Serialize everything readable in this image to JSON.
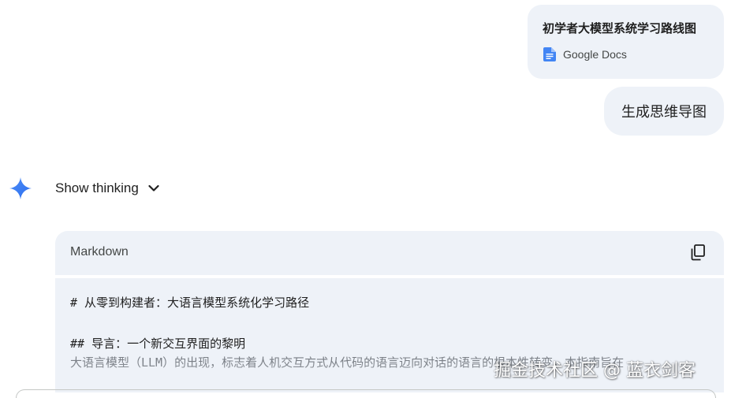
{
  "attachment": {
    "title": "初学者大模型系统学习路线图",
    "source_label": "Google Docs",
    "source_icon": "google-docs-icon",
    "source_icon_color": "#4285f4"
  },
  "user_message": {
    "text": "生成思维导图"
  },
  "response": {
    "avatar_icon": "gemini-spark-icon",
    "thinking_label": "Show thinking",
    "code_block": {
      "language": "Markdown",
      "copy_icon": "copy-icon",
      "lines": [
        "# 从零到构建者：大语言模型系统化学习路径",
        "",
        "## 导言：一个新交互界面的黎明",
        "大语言模型（LLM）的出现，标志着人机交互方式从代码的语言迈向对话的语言的根本性转变。本指南旨在"
      ]
    }
  },
  "watermark": "掘金技术社区 @ 蓝衣剑客",
  "colors": {
    "bubble_bg": "#eef2f8",
    "text": "#1f1f1f",
    "muted": "#444746",
    "gemini_blue": "#4285f4"
  }
}
